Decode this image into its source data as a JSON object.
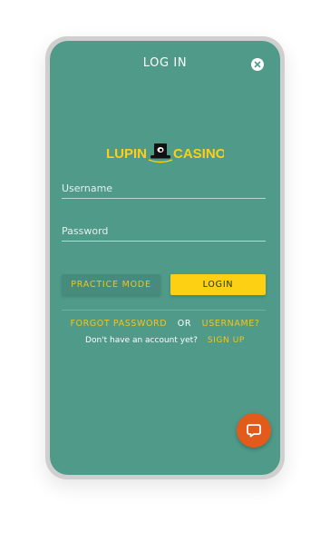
{
  "header": {
    "title": "LOG IN",
    "close_icon": "close-icon"
  },
  "logo": {
    "left_text": "LUPIN",
    "right_text": "CASINO",
    "brand_color": "#fdd013"
  },
  "form": {
    "username_placeholder": "Username",
    "password_placeholder": "Password",
    "practice_label": "PRACTICE MODE",
    "login_label": "LOGIN"
  },
  "links": {
    "forgot_password": "FORGOT PASSWORD",
    "or": "OR",
    "username": "USERNAME?",
    "no_account": "Don't have an account yet?",
    "sign_up": "SIGN UP"
  },
  "chat": {
    "icon": "chat-icon"
  },
  "colors": {
    "background": "#4f9a89",
    "accent": "#fdd013",
    "chat": "#e35b1b"
  }
}
